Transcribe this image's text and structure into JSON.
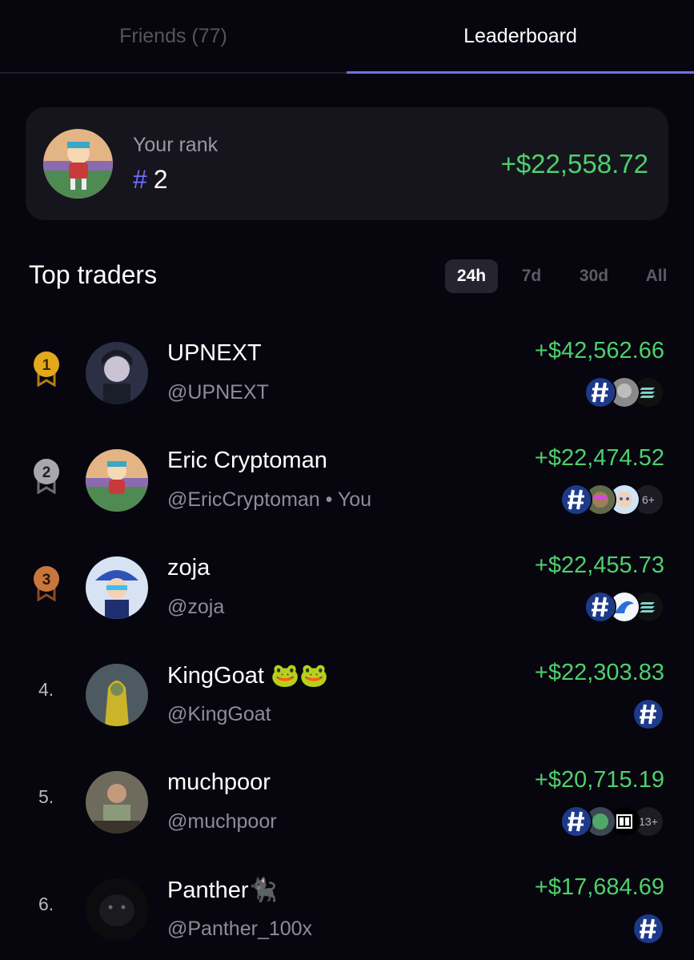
{
  "tabs": {
    "friends": "Friends (77)",
    "leaderboard": "Leaderboard"
  },
  "rank_card": {
    "label": "Your rank",
    "hash": "#",
    "rank": "2",
    "pnl": "+$22,558.72"
  },
  "section": {
    "title": "Top traders"
  },
  "filters": [
    "24h",
    "7d",
    "30d",
    "All"
  ],
  "traders": [
    {
      "rank": "1",
      "name": "UPNEXT",
      "handle": "@UPNEXT",
      "pnl": "+$42,562.66",
      "more": ""
    },
    {
      "rank": "2",
      "name": "Eric Cryptoman",
      "handle": "@EricCryptoman • You",
      "pnl": "+$22,474.52",
      "more": "6+"
    },
    {
      "rank": "3",
      "name": "zoja",
      "handle": "@zoja",
      "pnl": "+$22,455.73",
      "more": ""
    },
    {
      "rank": "4.",
      "name": "KingGoat 🐸🐸",
      "handle": "@KingGoat",
      "pnl": "+$22,303.83",
      "more": ""
    },
    {
      "rank": "5.",
      "name": "muchpoor",
      "handle": "@muchpoor",
      "pnl": "+$20,715.19",
      "more": "13+"
    },
    {
      "rank": "6.",
      "name": "Panther🐈‍⬛",
      "handle": "@Panther_100x",
      "pnl": "+$17,684.69",
      "more": ""
    }
  ],
  "colors": {
    "accent": "#6b70ff",
    "positive": "#4ed06a",
    "gold": "#d9a21b",
    "silver": "#9a9aa0",
    "bronze": "#c0703a"
  }
}
